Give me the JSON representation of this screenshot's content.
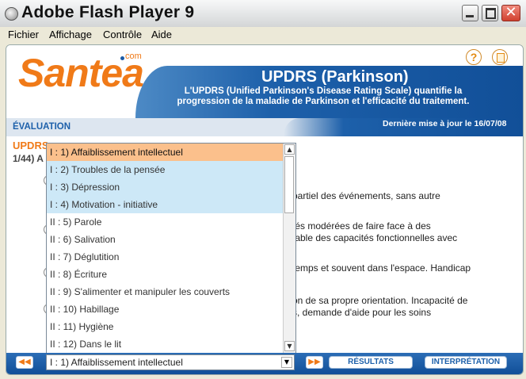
{
  "window": {
    "title": "Adobe Flash Player 9",
    "close_glyph": "✕"
  },
  "menu": [
    "Fichier",
    "Affichage",
    "Contrôle",
    "Aide"
  ],
  "header": {
    "logo": "Santea",
    "logo_suffix": "com",
    "help_glyph": "?",
    "title": "UPDRS (Parkinson)",
    "description": "L'UPDRS (Unified Parkinson's Disease Rating Scale) quantifie la progression de la maladie de Parkinson et l'efficacité du traitement.",
    "section_label": "ÉVALUATION",
    "updated": "Dernière mise à jour le 16/07/08"
  },
  "main": {
    "section_title": "UPDRS",
    "question": "1/44) A",
    "option_fragments": [
      "partiel des événements, sans autre",
      "tés modérées de faire face à des",
      "table des capacités fonctionnelles avec",
      "temps et souvent dans l'espace. Handicap",
      "on de sa propre orientation. Incapacité de",
      "s, demande d'aide pour les soins"
    ]
  },
  "dropdown": {
    "selected": "I : 1) Affaiblissement intellectuel",
    "items": [
      "I : 1) Affaiblissement intellectuel",
      "I : 2) Troubles de la pensée",
      "I : 3) Dépression",
      "I : 4) Motivation - initiative",
      "II : 5) Parole",
      "II : 6) Salivation",
      "II : 7) Déglutition",
      "II : 8) Écriture",
      "II : 9) S'alimenter et manipuler les couverts",
      "II : 10) Habillage",
      "II : 11) Hygiène",
      "II : 12) Dans le lit"
    ]
  },
  "footer": {
    "prev_glyph": "◀◀",
    "next_glyph": "▶▶",
    "results_label": "RÉSULTATS",
    "interpretation_label": "INTERPRÉTATION"
  }
}
